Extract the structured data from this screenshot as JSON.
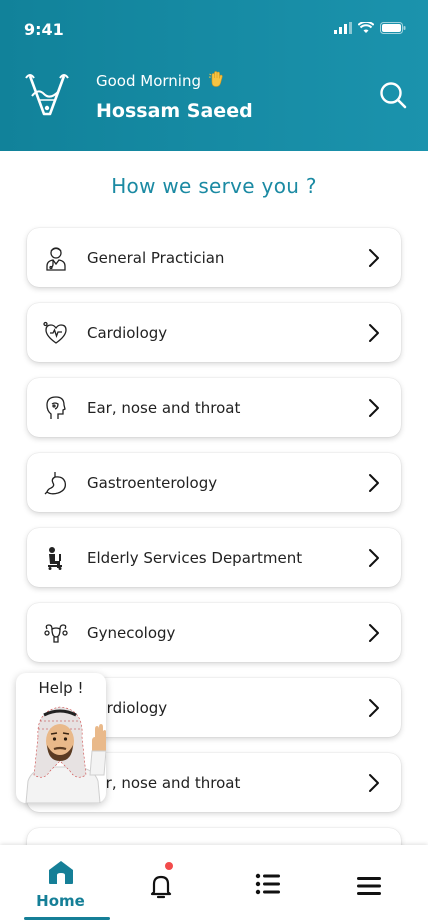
{
  "status_bar": {
    "time": "9:41"
  },
  "header": {
    "greeting": "Good Morning",
    "greeting_emoji": "waving-hand",
    "user_name": "Hossam Saeed",
    "brand_color": "#1588a1"
  },
  "section_title": "How we serve you ?",
  "services": [
    {
      "label": "General Practician",
      "icon": "doctor-icon"
    },
    {
      "label": "Cardiology",
      "icon": "heart-icon"
    },
    {
      "label": "Ear, nose and throat",
      "icon": "ent-head-icon"
    },
    {
      "label": "Gastroenterology",
      "icon": "stomach-icon"
    },
    {
      "label": "Elderly Services Department",
      "icon": "elderly-icon"
    },
    {
      "label": "Gynecology",
      "icon": "uterus-icon"
    },
    {
      "label": "Cardiology",
      "icon": "heart-icon"
    },
    {
      "label": "Ear, nose and throat",
      "icon": "ent-head-icon"
    }
  ],
  "help_widget": {
    "label": "Help !"
  },
  "tabbar": {
    "home_label": "Home",
    "accent_color": "#157f97",
    "notification_dot_color": "#f24b4b"
  }
}
